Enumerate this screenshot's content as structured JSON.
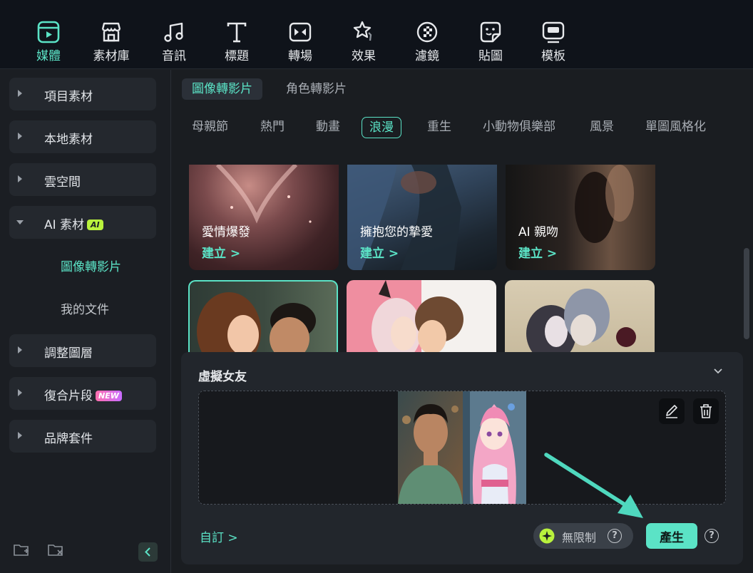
{
  "toolbar": {
    "items": [
      {
        "label": "媒體",
        "icon": "media-icon"
      },
      {
        "label": "素材庫",
        "icon": "store-icon"
      },
      {
        "label": "音訊",
        "icon": "music-note-icon"
      },
      {
        "label": "標題",
        "icon": "title-t-icon"
      },
      {
        "label": "轉場",
        "icon": "transition-icon"
      },
      {
        "label": "效果",
        "icon": "effects-star-icon"
      },
      {
        "label": "濾鏡",
        "icon": "filter-icon"
      },
      {
        "label": "貼圖",
        "icon": "sticker-icon"
      },
      {
        "label": "模板",
        "icon": "template-icon"
      }
    ],
    "active_index": 0
  },
  "sidebar": {
    "items": [
      {
        "label": "項目素材"
      },
      {
        "label": "本地素材"
      },
      {
        "label": "雲空間"
      },
      {
        "label": "AI 素材",
        "badge": "AI"
      },
      {
        "label": "調整圖層"
      },
      {
        "label": "復合片段",
        "badge": "NEW"
      },
      {
        "label": "品牌套件"
      }
    ],
    "subitems": [
      {
        "label": "圖像轉影片"
      },
      {
        "label": "我的文件"
      }
    ],
    "bottom_icons": [
      "new-folder-icon",
      "delete-folder-icon",
      "collapse-panel-icon"
    ]
  },
  "main": {
    "subtabs": [
      {
        "label": "圖像轉影片"
      },
      {
        "label": "角色轉影片"
      }
    ],
    "categories": [
      {
        "label": "母親節"
      },
      {
        "label": "熱門"
      },
      {
        "label": "動畫"
      },
      {
        "label": "浪漫"
      },
      {
        "label": "重生"
      },
      {
        "label": "小動物俱樂部"
      },
      {
        "label": "風景"
      },
      {
        "label": "單圖風格化"
      }
    ],
    "active_category": "浪漫",
    "cards": [
      {
        "title": "愛情爆發",
        "action": "建立 >"
      },
      {
        "title": "擁抱您的摯愛",
        "action": "建立 >"
      },
      {
        "title": "AI 親吻",
        "action": "建立 >"
      }
    ]
  },
  "panel": {
    "title": "虛擬女友",
    "custom_link": "自訂 >",
    "credit_text": "無限制",
    "generate_label": "產生",
    "help_symbol": "?"
  },
  "colors": {
    "accent": "#5be3c6",
    "background": "#1a1d21",
    "toolbar_bg": "#0f131a",
    "ai_badge": "#b9f23d"
  }
}
